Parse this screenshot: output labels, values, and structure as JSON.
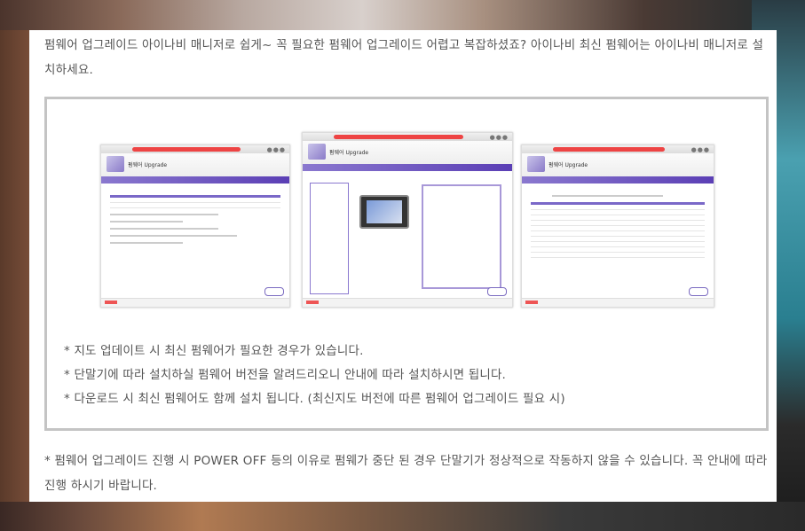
{
  "intro_text": "펌웨어 업그레이드 아이나비 매니저로 쉽게~ 꼭 필요한 펌웨어 업그레이드 어렵고 복잡하셨죠? 아이나비 최신 펌웨어는 아이나비 매니저로 설치하세요.",
  "screens": [
    {
      "name": "upgrade-screen-1",
      "title": "펌웨어 Upgrade"
    },
    {
      "name": "upgrade-screen-2",
      "title": "펌웨어 Upgrade"
    },
    {
      "name": "upgrade-screen-3",
      "title": "펌웨어 Upgrade"
    }
  ],
  "notes": [
    "* 지도 업데이트 시 최신 펌웨어가 필요한 경우가 있습니다.",
    "* 단말기에 따라 설치하실 펌웨어 버전을 알려드리오니 안내에 따라 설치하시면 됩니다.",
    "* 다운로드 시 최신 펌웨어도 함께 설치 됩니다. (최신지도 버전에 따른 펌웨어 업그레이드 필요 시)"
  ],
  "footer_note": "* 펌웨어 업그레이드 진행 시 POWER OFF 등의 이유로 펌웨가 중단 된 경우 단말기가 정상적으로 작동하지 않을 수 있습니다. 꼭 안내에 따라 진행 하시기 바랍니다."
}
